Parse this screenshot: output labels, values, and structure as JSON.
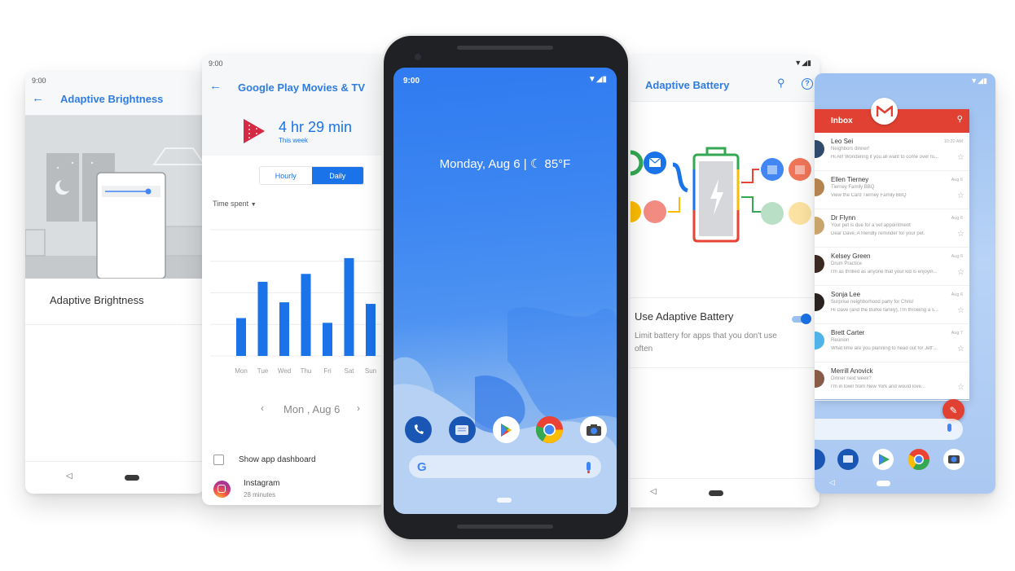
{
  "screens": {
    "adaptive_brightness": {
      "status_time": "9:00",
      "title": "Adaptive Brightness",
      "setting_label": "Adaptive Brightness",
      "brightness_level": 0.95
    },
    "digital_wellbeing": {
      "status_time": "9:00",
      "title": "Google Play Movies & TV",
      "usage_total": "4 hr 29 min",
      "usage_period": "This week",
      "toggle_options": [
        "Hourly",
        "Daily"
      ],
      "toggle_selected": "Daily",
      "metric_dropdown": "Time spent",
      "date_label": "Mon , Aug 6",
      "dashboard_label": "Show app dashboard",
      "apps": [
        {
          "name": "Instagram",
          "usage": "28 minutes"
        }
      ],
      "accent": "#1a73e8"
    },
    "home": {
      "status_time": "9:00",
      "at_a_glance": "Monday, Aug 6  |  ☾ 85°F",
      "dock_apps": [
        "Phone",
        "Messages",
        "Play Store",
        "Chrome",
        "Camera"
      ],
      "search_logo": "G"
    },
    "adaptive_battery": {
      "title": "Adaptive Battery",
      "setting_title": "Use Adaptive Battery",
      "setting_description": "Limit battery for apps that you don't use often",
      "setting_enabled": true
    },
    "gmail": {
      "header": "Inbox",
      "messages": [
        {
          "sender": "Leo Sei",
          "subject": "Neighbors dinner!",
          "snippet": "Hi All! Wondering if you all want to come over fo...",
          "date": "10:20 AM",
          "avatar_color": "#2f4a6b"
        },
        {
          "sender": "Ellen Tierney",
          "subject": "Tierney Family BBQ",
          "snippet": "View the Card Tierney Family BBQ",
          "date": "Aug 6",
          "avatar_color": "#b5834e"
        },
        {
          "sender": "Dr Flynn",
          "subject": "Your pet is due for a vet appointment",
          "snippet": "Dear Dave, A friendly reminder for your pet.",
          "date": "Aug 6",
          "avatar_color": "#c9a46b"
        },
        {
          "sender": "Kelsey Green",
          "subject": "Drum Practice",
          "snippet": "I'm as thrilled as anyone that your kid is enjoyin...",
          "date": "Aug 6",
          "avatar_color": "#3b2a22"
        },
        {
          "sender": "Sonja Lee",
          "subject": "Surprise neighborhood party for Chris!",
          "snippet": "Hi Dave (and the Burke family), I'm throwing a s...",
          "date": "Aug 6",
          "avatar_color": "#2a2220"
        },
        {
          "sender": "Brett Carter",
          "subject": "Reunion",
          "snippet": "What time are you planning to head out for Jeff'...",
          "date": "Aug 7",
          "avatar_color": "#4fb3ea"
        },
        {
          "sender": "Merrill Anovick",
          "subject": "Dinner next week?",
          "snippet": "I'm in town from New York and would love...",
          "date": "",
          "avatar_color": "#8a5a48"
        }
      ],
      "brand_color": "#e04132"
    }
  },
  "chart_data": {
    "type": "bar",
    "title": "",
    "categories": [
      "Mon",
      "Tue",
      "Wed",
      "Thu",
      "Fri",
      "Sat",
      "Sun"
    ],
    "values": [
      24,
      47,
      34,
      52,
      21,
      62,
      33
    ],
    "xlabel": "",
    "ylabel": "Time spent",
    "ylim": [
      0,
      80
    ],
    "grid": true,
    "color": "#1a73e8"
  }
}
